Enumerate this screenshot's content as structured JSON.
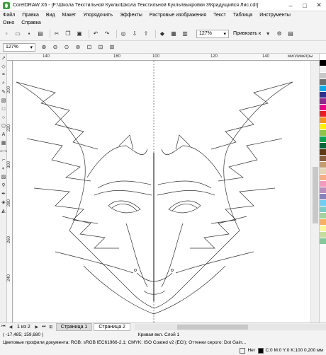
{
  "window": {
    "title": "CorelDRAW X6 - [F:\\Школа Текстильной Куклы\\Школа Текстильной Куклы\\выкройки 3\\Крадущийся Лис.cdr]",
    "minimize": "–",
    "maximize": "□",
    "close": "✕"
  },
  "menu": {
    "row1": [
      "Файл",
      "Правка",
      "Вид",
      "Макет",
      "Упорядочить",
      "Эффекты",
      "Растровые изображения",
      "Текст",
      "Таблица",
      "Инструменты"
    ],
    "row2": [
      "Окно",
      "Справка"
    ]
  },
  "toolbar": {
    "zoom_value": "127%",
    "snap_label": "Привязать к"
  },
  "propbar": {
    "zoom_value": "127%"
  },
  "ruler": {
    "h_labels": [
      "140",
      "160",
      "80",
      "100",
      "120",
      "140"
    ],
    "units": "миллиметры",
    "v_labels": [
      "200",
      "220",
      "300",
      "280",
      "260",
      "240"
    ]
  },
  "pages": {
    "count": "1 из 2",
    "tab1": "Страница 1",
    "tab2": "Страница 2"
  },
  "status": {
    "coords": "( -17,485; 159,680 )",
    "object": "Кривая вкл. Слой 1",
    "profile": "Цветовые профили документа: RGB: sRGB IEC61966-2.1; CMYK: ISO Coated v2 (ECI); Оттенки серого: Dot Gain...",
    "fill_label": "Нет",
    "outline_label": "C:0 M:0 Y:0 K:100  0,200 мм"
  },
  "palette_colors": [
    "#ffffff",
    "#000000",
    "#f2f2f2",
    "#c8c8c8",
    "#6d6d6d",
    "#00aeef",
    "#2e3192",
    "#92278f",
    "#ec008c",
    "#ed1c24",
    "#f7941d",
    "#fff200",
    "#8dc63f",
    "#00a651",
    "#006838",
    "#603913",
    "#8b5e3c",
    "#c69c6d",
    "#e7d4b5",
    "#f9ad81",
    "#f49ac1",
    "#bd8cbf",
    "#8781bd",
    "#6dcff6",
    "#7accc8",
    "#a3d39c",
    "#fbaf5d",
    "#fff799",
    "#c4df9b",
    "#82ca9c"
  ]
}
